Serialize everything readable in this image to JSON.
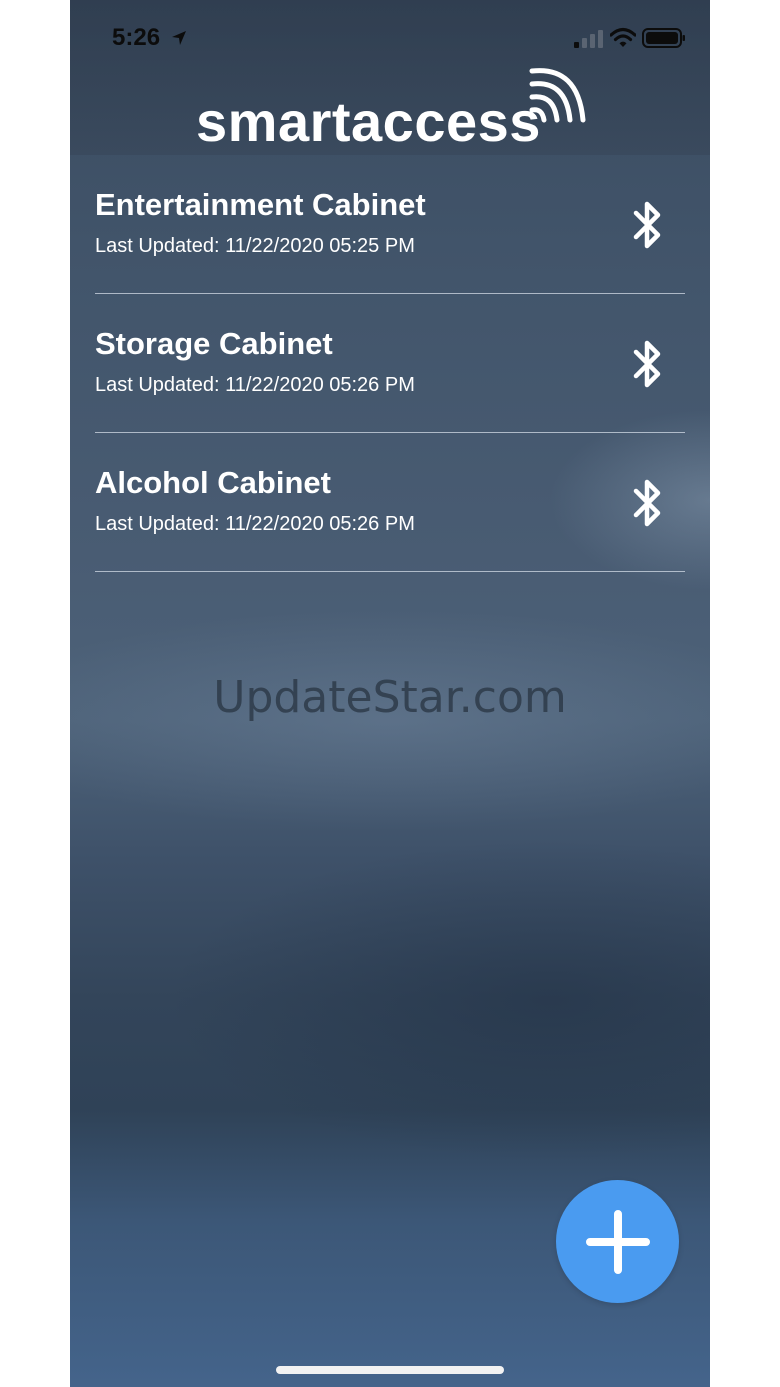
{
  "status_bar": {
    "time": "5:26",
    "icons": [
      "location-arrow-icon",
      "cellular-signal-icon",
      "wifi-icon",
      "battery-icon"
    ]
  },
  "header": {
    "logo_text": "smartaccess",
    "logo_icon": "wireless-waves-icon"
  },
  "cabinets": [
    {
      "name": "Entertainment Cabinet",
      "updated": "Last Updated: 11/22/2020 05:25 PM",
      "icon": "bluetooth-icon"
    },
    {
      "name": "Storage Cabinet",
      "updated": "Last Updated: 11/22/2020 05:26 PM",
      "icon": "bluetooth-icon"
    },
    {
      "name": "Alcohol Cabinet",
      "updated": "Last Updated: 11/22/2020 05:26 PM",
      "icon": "bluetooth-icon"
    }
  ],
  "watermark": "UpdateStar.com",
  "fab": {
    "icon": "plus-icon",
    "color": "#4a9bf0"
  }
}
